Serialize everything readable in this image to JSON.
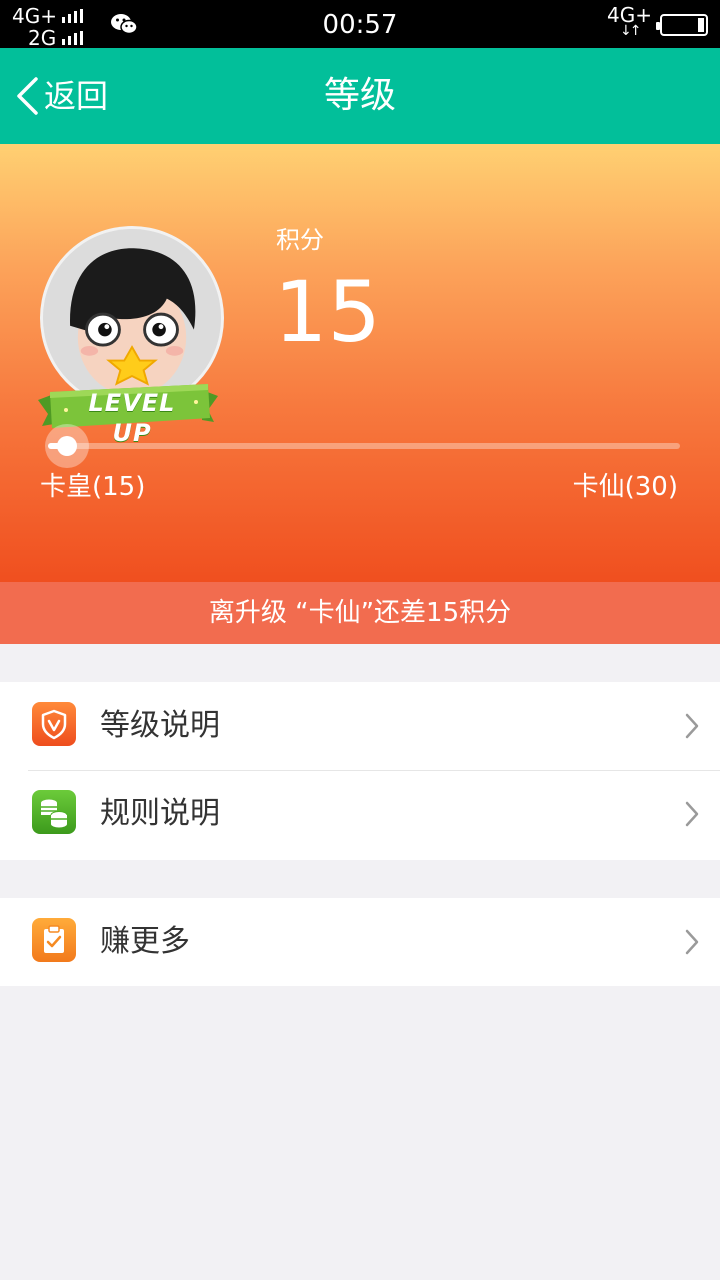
{
  "status_bar": {
    "network_top": "4G+",
    "network_bottom": "2G",
    "time": "00:57",
    "network_right": "4G+",
    "data_arrows": "↓↑",
    "battery_level": 0.15
  },
  "header": {
    "back_label": "返回",
    "title": "等级"
  },
  "level_card": {
    "points_label": "积分",
    "points_value": "15",
    "badge_text": "LEVEL UP",
    "current_level": "卡皇(15)",
    "next_level": "卡仙(30)",
    "progress": 0.03
  },
  "notice": {
    "text": "离升级 “卡仙”还差15积分"
  },
  "menu": {
    "level_desc": {
      "label": "等级说明",
      "icon": "shield-v-icon",
      "color": "#f05a24"
    },
    "rules_desc": {
      "label": "规则说明",
      "icon": "coins-icon",
      "color": "#4caf24"
    },
    "earn_more": {
      "label": "赚更多",
      "icon": "clipboard-check-icon",
      "color": "#f58a22"
    }
  },
  "colors": {
    "header": "#02bf9a",
    "notice": "#f26c4f",
    "background": "#f2f1f4"
  }
}
